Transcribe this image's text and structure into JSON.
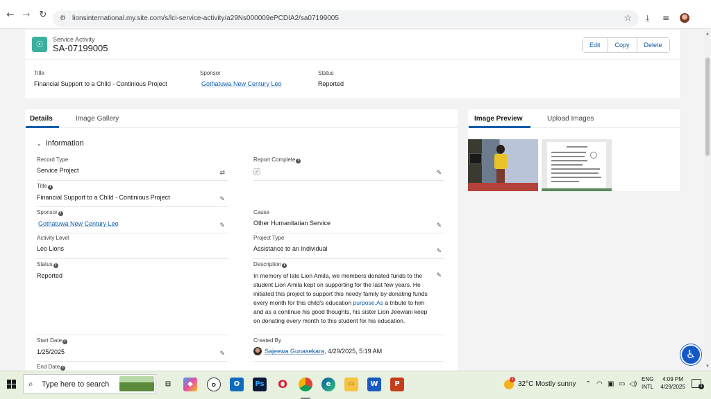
{
  "browser": {
    "url": "lionsinternational.my.site.com/s/lci-service-activity/a29Ns000009ePCDIA2/sa07199005"
  },
  "header": {
    "object_type": "Service Activity",
    "record_name": "SA-07199005",
    "buttons": {
      "edit": "Edit",
      "copy": "Copy",
      "delete": "Delete"
    }
  },
  "highlights": {
    "title_label": "Title",
    "title_value": "Financial Support to a Child - Continious Project",
    "sponsor_label": "Sponsor",
    "sponsor_value": "Gothatuwa New Century Leo",
    "status_label": "Status",
    "status_value": "Reported"
  },
  "tabs": {
    "details": "Details",
    "gallery": "Image Gallery"
  },
  "section": {
    "title": "Information"
  },
  "fields": {
    "record_type_label": "Record Type",
    "record_type_value": "Service Project",
    "report_complete_label": "Report Complete",
    "title_label": "Title",
    "title_value": "Financial Support to a Child - Continious Project",
    "sponsor_label": "Sponsor",
    "sponsor_value": "Gothatuwa New Century Leo",
    "cause_label": "Cause",
    "cause_value": "Other Humanitarian Service",
    "activity_level_label": "Activity Level",
    "activity_level_value": "Leo Lions",
    "project_type_label": "Project Type",
    "project_type_value": "Assistance to an Individual",
    "status_label": "Status",
    "status_value": "Reported",
    "description_label": "Description",
    "description_part1": "In memory of late Lion Amila, we members donated funds to the student Lion Amila kept on supporting for the last few years. He initiated this project to support this needy family by donating funds every month for this child's education ",
    "description_link": "purpose.As",
    "description_part2": " a tribute to him and as a continue his good thoughts, his sister Lion Jeewani keep on donating every month to this student for his education.",
    "start_date_label": "Start Date",
    "start_date_value": "1/25/2025",
    "created_by_label": "Created By",
    "created_by_name": "Sajeewa Gunasekara",
    "created_by_date": ", 4/29/2025, 5:19 AM",
    "end_date_label": "End Date"
  },
  "preview_tabs": {
    "preview": "Image Preview",
    "upload": "Upload Images"
  },
  "taskbar": {
    "search_placeholder": "Type here to search",
    "weather_badge": "1",
    "weather": "32°C  Mostly sunny",
    "lang_line1": "ENG",
    "lang_line2": "INTL",
    "time": "4:09 PM",
    "date": "4/29/2025",
    "notif_count": "1"
  },
  "colors": {
    "accent": "#0b5cab",
    "object_icon": "#3ab09e",
    "a11y": "#1458c8"
  }
}
